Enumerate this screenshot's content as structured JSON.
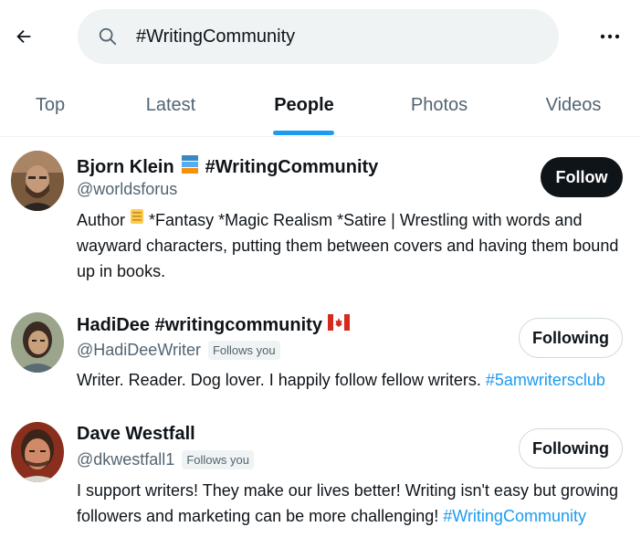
{
  "search": {
    "query": "#WritingCommunity"
  },
  "tabs": [
    {
      "label": "Top"
    },
    {
      "label": "Latest"
    },
    {
      "label": "People"
    },
    {
      "label": "Photos"
    },
    {
      "label": "Videos"
    }
  ],
  "active_tab": "People",
  "people": [
    {
      "name": "Bjorn Klein",
      "name_suffix": "#WritingCommunity",
      "handle": "@worldsforus",
      "follows_you": "",
      "button": "Follow",
      "bio_prefix": "Author",
      "bio_main": "*Fantasy *Magic Realism *Satire | Wrestling with words and wayward characters, putting them between covers and having them bound up in books.",
      "bio_hashtag": ""
    },
    {
      "name": "HadiDee #writingcommunity",
      "handle": "@HadiDeeWriter",
      "follows_you": "Follows you",
      "button": "Following",
      "bio_main": "Writer. Reader. Dog lover. I happily follow fellow writers.",
      "bio_hashtag": "#5amwritersclub"
    },
    {
      "name": "Dave Westfall",
      "handle": "@dkwestfall1",
      "follows_you": "Follows you",
      "button": "Following",
      "bio_main": "I support writers! They make our lives better! Writing isn't easy but growing followers and marketing can be more challenging!",
      "bio_hashtag": "#WritingCommunity"
    }
  ],
  "colors": {
    "accent": "#1d9bf0",
    "text": "#0f1419",
    "muted": "#536471",
    "search_bg": "#eff3f4"
  }
}
